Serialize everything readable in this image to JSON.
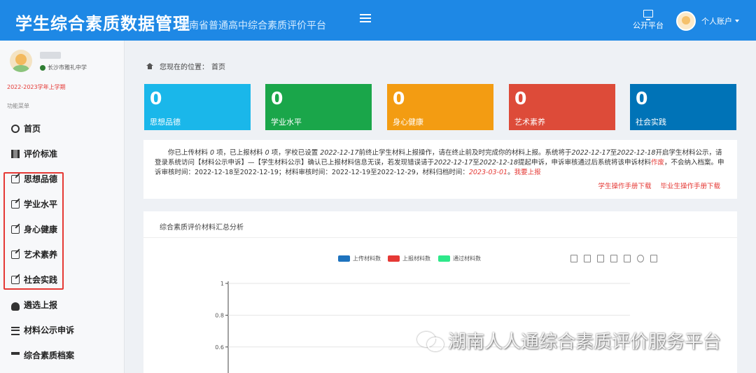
{
  "header": {
    "title": "学生综合素质数据管理",
    "subtitle": "湖南省普通高中综合素质评价平台",
    "public_platform": "公开平台",
    "account": "个人账户"
  },
  "sidebar": {
    "school": "长沙市雅礼中学",
    "term": "2022-2023学年上学期",
    "menu_heading": "功能菜单",
    "items": [
      {
        "label": "首页",
        "icon": "dashboard-icon"
      },
      {
        "label": "评价标准",
        "icon": "map-icon"
      },
      {
        "label": "思想品德",
        "icon": "edit-icon"
      },
      {
        "label": "学业水平",
        "icon": "edit-icon"
      },
      {
        "label": "身心健康",
        "icon": "edit-icon"
      },
      {
        "label": "艺术素养",
        "icon": "edit-icon"
      },
      {
        "label": "社会实践",
        "icon": "edit-icon"
      },
      {
        "label": "遴选上报",
        "icon": "cloud-upload-icon"
      },
      {
        "label": "材料公示申诉",
        "icon": "list-icon"
      },
      {
        "label": "综合素质档案",
        "icon": "graduation-cap-icon"
      }
    ]
  },
  "breadcrumb": {
    "prefix": "您现在的位置：",
    "current": "首页"
  },
  "stats": [
    {
      "value": "0",
      "label": "思想品德",
      "color": "#1ab7ea"
    },
    {
      "value": "0",
      "label": "学业水平",
      "color": "#1aa64a"
    },
    {
      "value": "0",
      "label": "身心健康",
      "color": "#f39c12"
    },
    {
      "value": "0",
      "label": "艺术素养",
      "color": "#dd4b39"
    },
    {
      "value": "0",
      "label": "社会实践",
      "color": "#0073b7"
    }
  ],
  "notice": {
    "p1": "你已上传材料",
    "uploaded": "0",
    "p2": "项，已上报材料",
    "reported": "0",
    "p3": "项，学校已设置",
    "deadline": "2022-12-17",
    "p4": "前终止学生材料上报操作，请在终止前及时完成你的材料上报。系统将于",
    "pub_start": "2022-12-17",
    "p5": "至",
    "pub_end": "2022-12-18",
    "p6": "开启学生材料公示，请登录系统访问【材料公示申诉】—【学生材料公示】确认已上报材料信息无误，若发现错误请于",
    "appeal_start": "2022-12-17",
    "p7": "至",
    "appeal_end": "2022-12-18",
    "p8": "提起申诉，申诉审核通过后系统将该申诉材料",
    "void_word": "作废",
    "p9": "，不会纳入档案。申诉审核时间：2022-12-18至2022-12-19；材料审核时间：2022-12-19至2022-12-29，材料归档时间：",
    "archive_date": "2023-03-01",
    "p10": "。",
    "report_link": "我要上报",
    "student_manual": "学生操作手册下载",
    "grad_manual": "毕业生操作手册下载"
  },
  "chart_panel": {
    "title": "综合素质评价材料汇总分析",
    "toolbox": [
      "data-view-icon",
      "line-icon",
      "bar-icon",
      "stack-icon",
      "tiled-icon",
      "restore-icon",
      "download-icon"
    ]
  },
  "chart_data": {
    "type": "bar",
    "categories": [],
    "series": [
      {
        "name": "上传材料数",
        "color": "#1e73be",
        "values": []
      },
      {
        "name": "上报材料数",
        "color": "#e53935",
        "values": []
      },
      {
        "name": "通过材料数",
        "color": "#2ee88a",
        "values": []
      }
    ],
    "y_ticks": [
      "1",
      "0.8",
      "0.6"
    ],
    "ylim": [
      0,
      1
    ],
    "grid": true,
    "legend_position": "top-center"
  },
  "watermark": "湖南人人通综合素质评价服务平台"
}
